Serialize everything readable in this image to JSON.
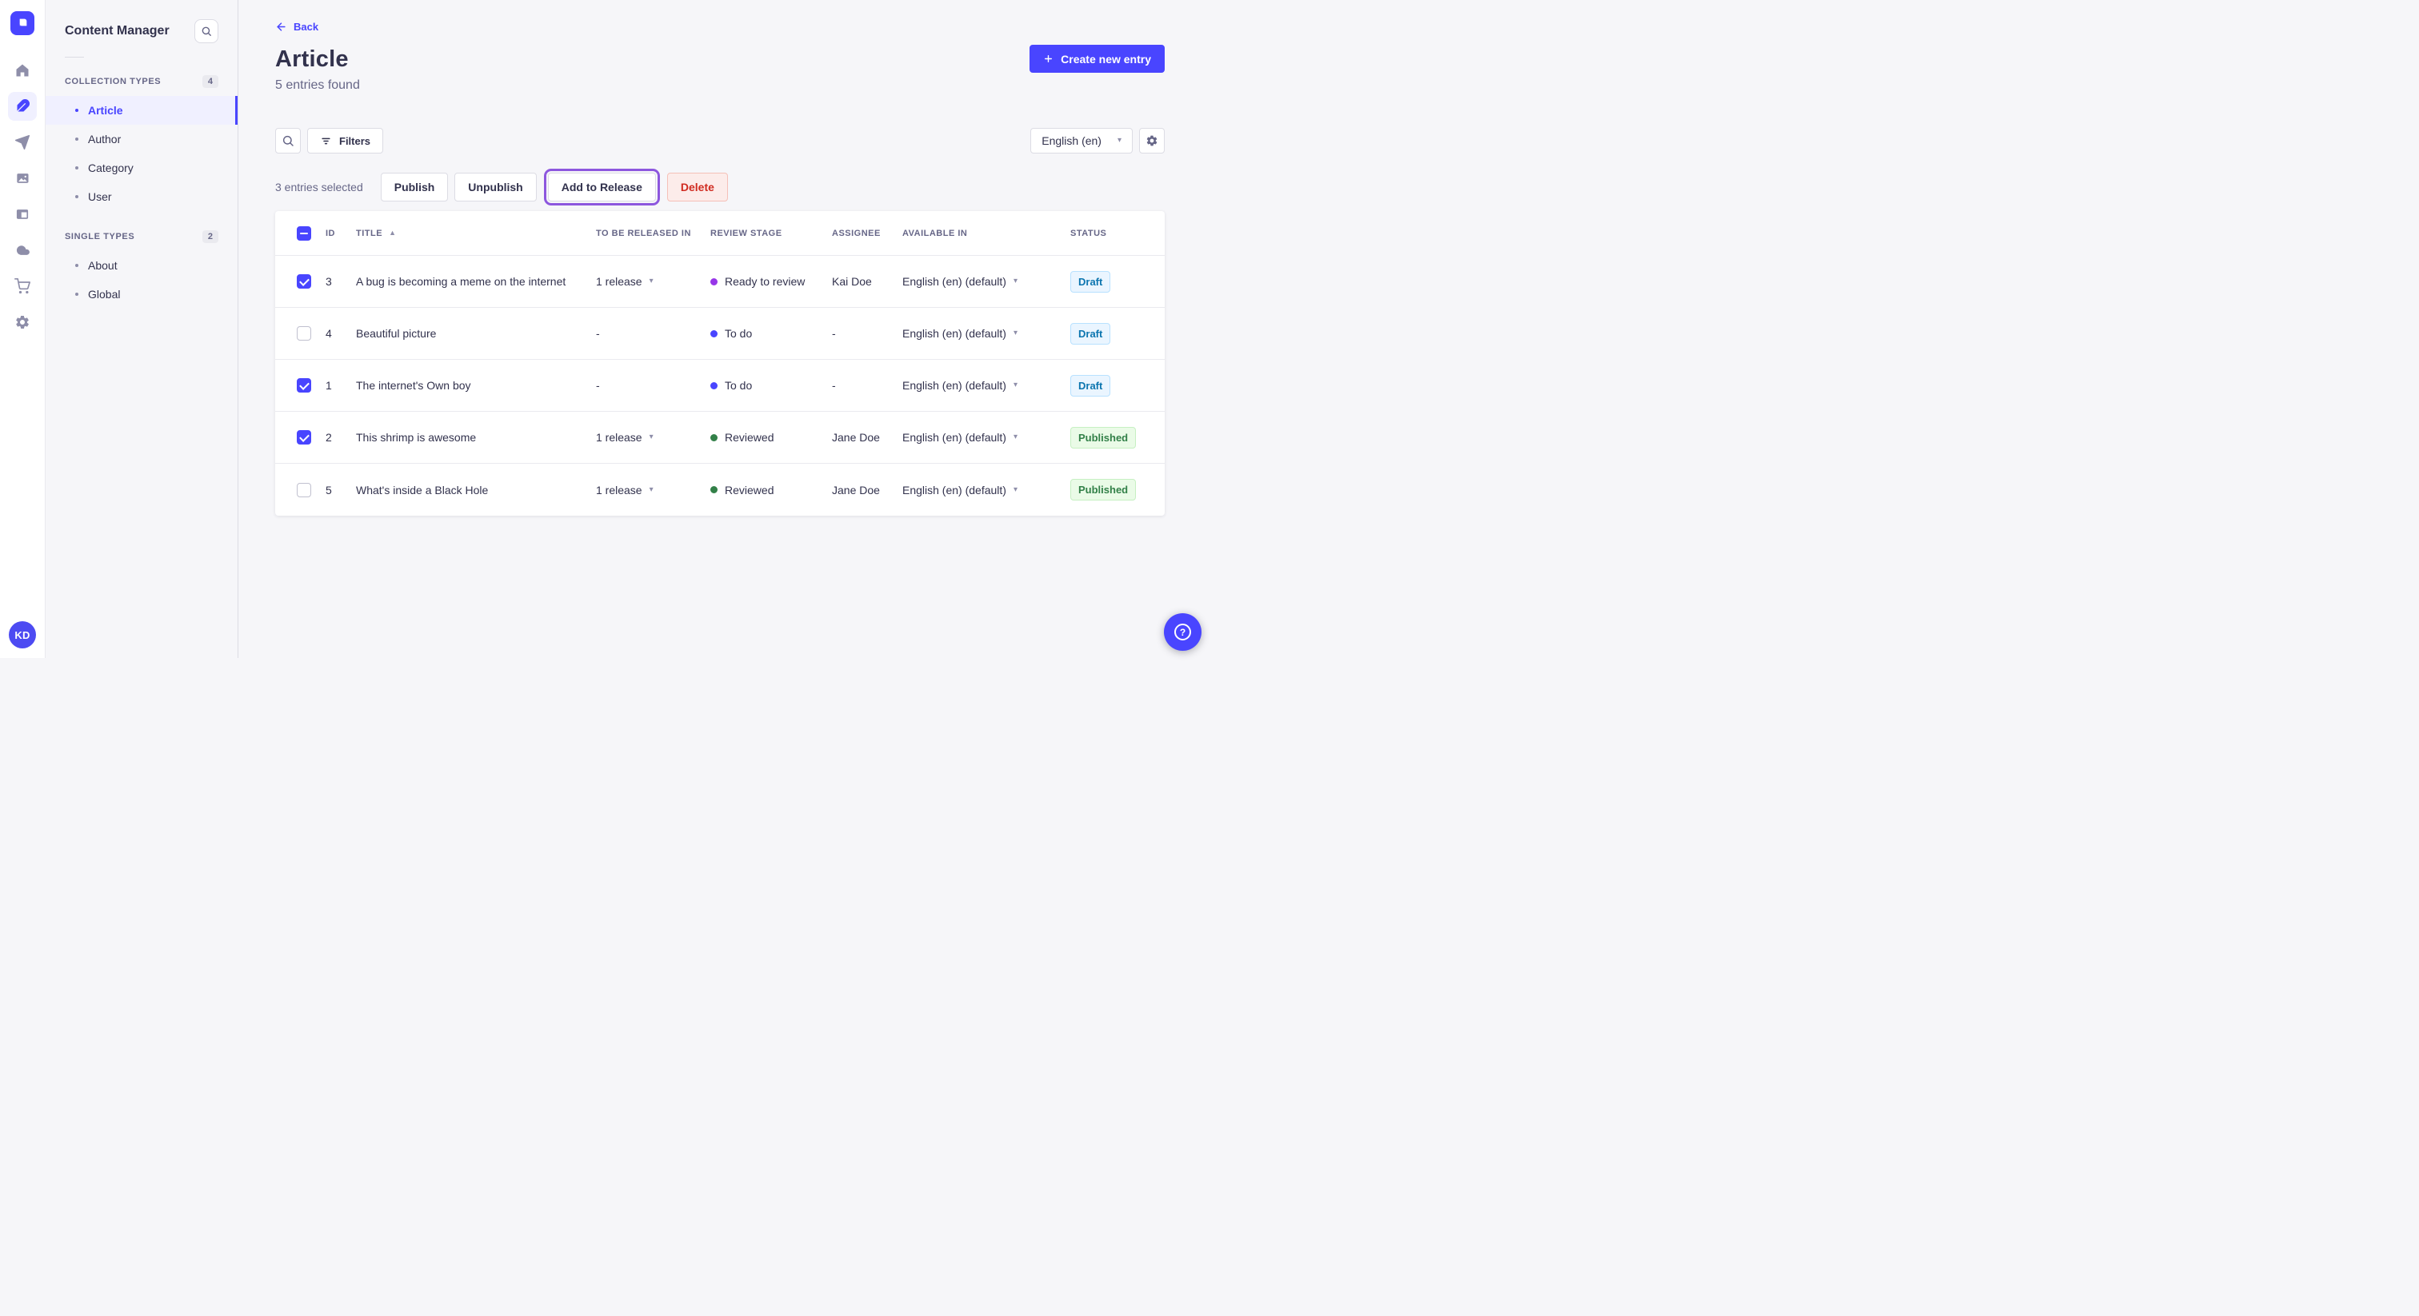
{
  "rail": {
    "avatar_initials": "KD",
    "icons": [
      "home",
      "content-manager",
      "releases",
      "media-library",
      "content-type-builder",
      "deploy",
      "marketplace",
      "settings"
    ],
    "active_icon": "content-manager"
  },
  "sidebar": {
    "title": "Content Manager",
    "sections": [
      {
        "label": "COLLECTION TYPES",
        "count": "4",
        "items": [
          {
            "label": "Article",
            "active": true
          },
          {
            "label": "Author",
            "active": false
          },
          {
            "label": "Category",
            "active": false
          },
          {
            "label": "User",
            "active": false
          }
        ]
      },
      {
        "label": "SINGLE TYPES",
        "count": "2",
        "items": [
          {
            "label": "About",
            "active": false
          },
          {
            "label": "Global",
            "active": false
          }
        ]
      }
    ]
  },
  "header": {
    "back_label": "Back",
    "title": "Article",
    "subtitle": "5 entries found",
    "create_button_label": "Create new entry"
  },
  "toolbar": {
    "filters_label": "Filters",
    "locale_value": "English (en)"
  },
  "selection": {
    "count_text": "3 entries selected",
    "publish_label": "Publish",
    "unpublish_label": "Unpublish",
    "add_to_release_label": "Add to Release",
    "delete_label": "Delete"
  },
  "table": {
    "columns": {
      "id": "ID",
      "title": "TITLE",
      "release": "TO BE RELEASED IN",
      "stage": "REVIEW STAGE",
      "assignee": "ASSIGNEE",
      "available": "AVAILABLE IN",
      "status": "STATUS"
    },
    "rows": [
      {
        "checked": true,
        "id": "3",
        "title": "A bug is becoming a meme on the internet",
        "release": "1 release",
        "release_caret": true,
        "stage": "Ready to review",
        "stage_color": "#9736e8",
        "assignee": "Kai Doe",
        "available": "English (en) (default)",
        "status": "Draft",
        "status_variant": "draft"
      },
      {
        "checked": false,
        "id": "4",
        "title": "Beautiful picture",
        "release": "-",
        "release_caret": false,
        "stage": "To do",
        "stage_color": "#4945ff",
        "assignee": "-",
        "available": "English (en) (default)",
        "status": "Draft",
        "status_variant": "draft"
      },
      {
        "checked": true,
        "id": "1",
        "title": "The internet's Own boy",
        "release": "-",
        "release_caret": false,
        "stage": "To do",
        "stage_color": "#4945ff",
        "assignee": "-",
        "available": "English (en) (default)",
        "status": "Draft",
        "status_variant": "draft"
      },
      {
        "checked": true,
        "id": "2",
        "title": "This shrimp is awesome",
        "release": "1 release",
        "release_caret": true,
        "stage": "Reviewed",
        "stage_color": "#328048",
        "assignee": "Jane Doe",
        "available": "English (en) (default)",
        "status": "Published",
        "status_variant": "published"
      },
      {
        "checked": false,
        "id": "5",
        "title": "What's inside a Black Hole",
        "release": "1 release",
        "release_caret": true,
        "stage": "Reviewed",
        "stage_color": "#328048",
        "assignee": "Jane Doe",
        "available": "English (en) (default)",
        "status": "Published",
        "status_variant": "published"
      }
    ]
  },
  "colors": {
    "accent": "#4945ff",
    "highlight_ring": "#8d57de",
    "draft_text": "#0c75af",
    "published_text": "#328048",
    "danger_text": "#d02b20"
  }
}
